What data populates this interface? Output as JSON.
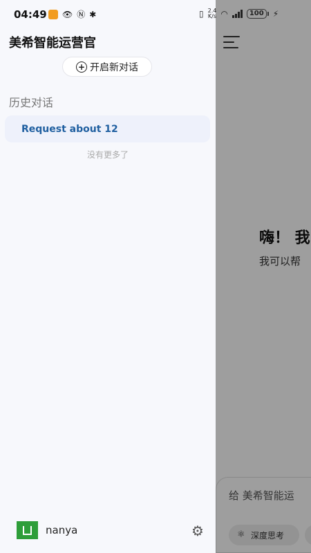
{
  "status_bar": {
    "time": "04:49",
    "net_speed_top": "2.4",
    "net_speed_bottom": "K/s",
    "battery": "100"
  },
  "main": {
    "greeting": "嗨！ 我",
    "subtitle": "我可以帮",
    "input_placeholder": "给 美希智能运",
    "deep_think_label": "深度思考"
  },
  "drawer": {
    "app_title": "美希智能运营官",
    "new_chat_label": "开启新对话",
    "history_title": "历史对话",
    "history_items": [
      "Request about 12"
    ],
    "no_more_text": "没有更多了",
    "username": "nanya"
  },
  "colors": {
    "accent_text": "#1f5fa0",
    "avatar_bg": "#2e9e3a",
    "drawer_bg": "#f7f8fc"
  }
}
